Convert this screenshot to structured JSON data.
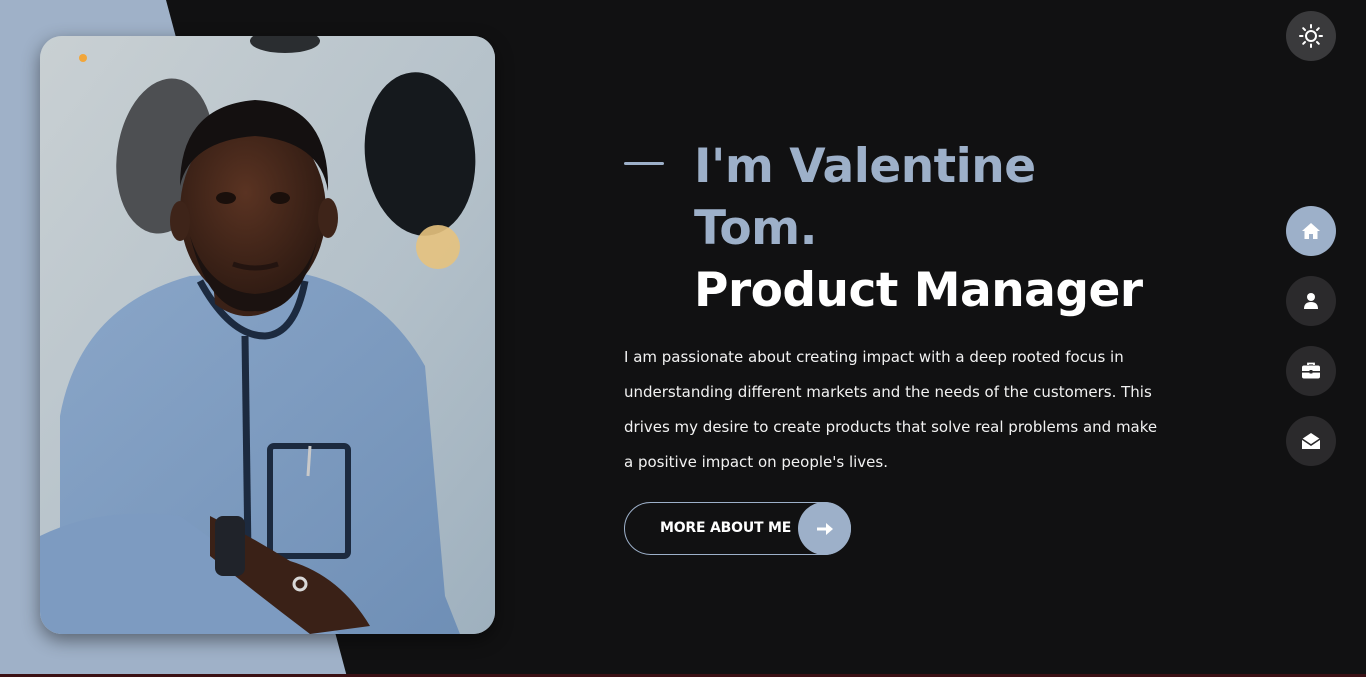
{
  "colors": {
    "background": "#111112",
    "accent": "#9db0c9",
    "title_name": "#9db0c9",
    "title_role": "#ffffff",
    "body_text": "#f2f2f2",
    "nav_button": "#2b2a2c",
    "nav_button_active": "#9db0c9"
  },
  "theme_toggle": {
    "icon": "sun-icon"
  },
  "side_nav": {
    "items": [
      {
        "icon": "home-icon",
        "active": true
      },
      {
        "icon": "user-icon",
        "active": false
      },
      {
        "icon": "briefcase-icon",
        "active": false
      },
      {
        "icon": "envelope-open-icon",
        "active": false
      }
    ]
  },
  "hero": {
    "name": "I'm Valentine Tom.",
    "role": "Product Manager",
    "description": "I am passionate about creating impact with a deep rooted focus in understanding different markets and the needs of the customers. This drives my desire to create products that solve real problems and make a positive impact on people's lives.",
    "cta_label": "More About Me",
    "cta_icon": "arrow-right-icon"
  },
  "photo": {
    "subject": "profile-photo"
  }
}
